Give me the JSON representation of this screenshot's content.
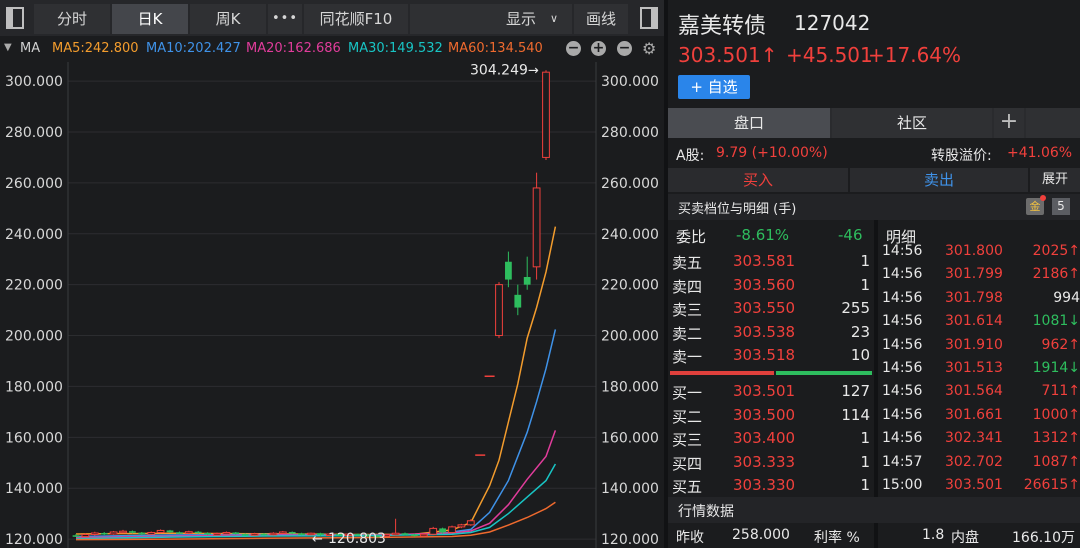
{
  "toolbar": {
    "tabs": [
      {
        "label": "分时",
        "active": false
      },
      {
        "label": "日K",
        "active": true
      },
      {
        "label": "周K",
        "active": false
      }
    ],
    "more_label": "•••",
    "f10_label": "同花顺F10",
    "display_label": "显示",
    "draw_label": "画线"
  },
  "ma_legend": {
    "label": "MA",
    "items": [
      {
        "text": "MA5:242.800",
        "color": "#f39c2d"
      },
      {
        "text": "MA10:202.427",
        "color": "#3f92e8"
      },
      {
        "text": "MA20:162.686",
        "color": "#e13c9b"
      },
      {
        "text": "MA30:149.532",
        "color": "#18c4c4"
      },
      {
        "text": "MA60:134.540",
        "color": "#ef6a2e"
      }
    ],
    "tools": [
      "−",
      "+",
      "−"
    ]
  },
  "colors": {
    "up": "#f0403c",
    "down": "#2ebd5e",
    "grid": "#2c2d30",
    "axis_text": "#d8d8d8",
    "ma5": "#f39c2d",
    "ma10": "#3f92e8",
    "ma20": "#e13c9b",
    "ma30": "#18c4c4",
    "ma60": "#ef6a2e"
  },
  "chart_data": {
    "type": "candlestick",
    "y_ticks": [
      "300.000",
      "280.000",
      "260.000",
      "240.000",
      "220.000",
      "200.000",
      "180.000",
      "160.000",
      "140.000",
      "120.000"
    ],
    "y_tick_values": [
      300,
      280,
      260,
      240,
      220,
      200,
      180,
      160,
      140,
      120
    ],
    "ylim": [
      116.5,
      307.5
    ],
    "max_label": "304.249",
    "max_value": 304.249,
    "min_label": "120.803",
    "min_value": 120.803,
    "candles": [
      {
        "o": 121.5,
        "c": 121.0,
        "h": 122.0,
        "l": 120.8
      },
      {
        "o": 121.0,
        "c": 121.8,
        "h": 122.3,
        "l": 120.8
      },
      {
        "o": 121.8,
        "c": 122.4,
        "h": 122.9,
        "l": 121.4
      },
      {
        "o": 122.4,
        "c": 122.0,
        "h": 122.8,
        "l": 121.6
      },
      {
        "o": 122.0,
        "c": 122.8,
        "h": 123.2,
        "l": 121.7
      },
      {
        "o": 122.8,
        "c": 123.1,
        "h": 123.6,
        "l": 122.4
      },
      {
        "o": 123.1,
        "c": 122.5,
        "h": 123.4,
        "l": 122.2
      },
      {
        "o": 122.5,
        "c": 121.9,
        "h": 122.8,
        "l": 121.5
      },
      {
        "o": 121.9,
        "c": 122.6,
        "h": 123.0,
        "l": 121.6
      },
      {
        "o": 122.6,
        "c": 123.4,
        "h": 123.8,
        "l": 122.3
      },
      {
        "o": 123.4,
        "c": 122.7,
        "h": 123.6,
        "l": 122.4
      },
      {
        "o": 122.7,
        "c": 122.3,
        "h": 123.0,
        "l": 122.0
      },
      {
        "o": 122.3,
        "c": 122.9,
        "h": 123.3,
        "l": 122.0
      },
      {
        "o": 122.9,
        "c": 122.4,
        "h": 123.2,
        "l": 122.1
      },
      {
        "o": 122.4,
        "c": 121.8,
        "h": 122.7,
        "l": 121.5
      },
      {
        "o": 121.8,
        "c": 122.2,
        "h": 122.6,
        "l": 121.5
      },
      {
        "o": 122.2,
        "c": 122.6,
        "h": 123.0,
        "l": 121.9
      },
      {
        "o": 122.6,
        "c": 122.0,
        "h": 122.8,
        "l": 121.7
      },
      {
        "o": 122.0,
        "c": 121.6,
        "h": 122.3,
        "l": 121.3
      },
      {
        "o": 121.6,
        "c": 122.1,
        "h": 122.5,
        "l": 121.3
      },
      {
        "o": 122.1,
        "c": 121.7,
        "h": 122.4,
        "l": 121.4
      },
      {
        "o": 121.7,
        "c": 122.3,
        "h": 122.7,
        "l": 121.4
      },
      {
        "o": 122.3,
        "c": 122.8,
        "h": 123.2,
        "l": 122.0
      },
      {
        "o": 122.8,
        "c": 122.2,
        "h": 123.0,
        "l": 121.9
      },
      {
        "o": 122.2,
        "c": 121.8,
        "h": 122.5,
        "l": 121.5
      },
      {
        "o": 121.8,
        "c": 122.3,
        "h": 122.6,
        "l": 121.5
      },
      {
        "o": 122.3,
        "c": 121.6,
        "h": 122.5,
        "l": 121.2
      },
      {
        "o": 121.6,
        "c": 122.0,
        "h": 122.4,
        "l": 121.2
      },
      {
        "o": 122.0,
        "c": 121.5,
        "h": 122.2,
        "l": 121.2
      },
      {
        "o": 121.5,
        "c": 122.0,
        "h": 122.3,
        "l": 121.2
      },
      {
        "o": 122.0,
        "c": 121.7,
        "h": 122.2,
        "l": 121.4
      },
      {
        "o": 121.7,
        "c": 121.3,
        "h": 121.9,
        "l": 120.9
      },
      {
        "o": 121.3,
        "c": 121.1,
        "h": 121.6,
        "l": 120.8
      },
      {
        "o": 121.1,
        "c": 121.7,
        "h": 122.0,
        "l": 120.8
      },
      {
        "o": 121.7,
        "c": 122.3,
        "h": 128.0,
        "l": 121.4
      },
      {
        "o": 122.3,
        "c": 121.8,
        "h": 122.6,
        "l": 121.4
      },
      {
        "o": 121.8,
        "c": 121.2,
        "h": 122.1,
        "l": 120.9
      },
      {
        "o": 121.2,
        "c": 121.9,
        "h": 122.2,
        "l": 120.9
      },
      {
        "o": 121.9,
        "c": 124.2,
        "h": 124.8,
        "l": 121.6
      },
      {
        "o": 124.2,
        "c": 122.6,
        "h": 124.5,
        "l": 122.2
      },
      {
        "o": 122.6,
        "c": 124.8,
        "h": 125.3,
        "l": 122.4
      },
      {
        "o": 124.8,
        "c": 125.6,
        "h": 126.0,
        "l": 124.3
      },
      {
        "o": 125.6,
        "c": 127.2,
        "h": 127.8,
        "l": 125.2
      },
      {
        "o": 153.0,
        "c": 153.0,
        "h": 153.0,
        "l": 153.0
      },
      {
        "o": 184.0,
        "c": 184.0,
        "h": 184.0,
        "l": 184.0
      },
      {
        "o": 200.0,
        "c": 220.0,
        "h": 221.0,
        "l": 199.0
      },
      {
        "o": 229.0,
        "c": 222.0,
        "h": 233.0,
        "l": 219.0
      },
      {
        "o": 216.0,
        "c": 211.0,
        "h": 220.0,
        "l": 208.0
      },
      {
        "o": 223.0,
        "c": 220.0,
        "h": 231.0,
        "l": 218.0
      },
      {
        "o": 227.0,
        "c": 258.0,
        "h": 264.0,
        "l": 222.0
      },
      {
        "o": 270.0,
        "c": 303.5,
        "h": 304.249,
        "l": 269.0
      }
    ],
    "ma": [
      {
        "name": "MA5",
        "color_key": "ma5",
        "values": [
          [
            0,
            122.0
          ],
          [
            10,
            122.3
          ],
          [
            20,
            122.1
          ],
          [
            30,
            121.8
          ],
          [
            36,
            121.9
          ],
          [
            40,
            123.6
          ],
          [
            42,
            126.5
          ],
          [
            44,
            141.0
          ],
          [
            45,
            151.0
          ],
          [
            46,
            166.0
          ],
          [
            47,
            181.0
          ],
          [
            48,
            199.0
          ],
          [
            49,
            211.0
          ],
          [
            50,
            225.0
          ],
          [
            51,
            242.8
          ]
        ]
      },
      {
        "name": "MA10",
        "color_key": "ma10",
        "values": [
          [
            0,
            121.0
          ],
          [
            10,
            121.6
          ],
          [
            20,
            121.8
          ],
          [
            30,
            121.6
          ],
          [
            38,
            121.8
          ],
          [
            42,
            123.8
          ],
          [
            44,
            130.5
          ],
          [
            46,
            143.0
          ],
          [
            48,
            162.0
          ],
          [
            49,
            174.0
          ],
          [
            50,
            187.0
          ],
          [
            51,
            202.4
          ]
        ]
      },
      {
        "name": "MA20",
        "color_key": "ma20",
        "values": [
          [
            0,
            120.6
          ],
          [
            10,
            121.1
          ],
          [
            20,
            121.6
          ],
          [
            30,
            121.4
          ],
          [
            40,
            122.4
          ],
          [
            42,
            123.2
          ],
          [
            44,
            126.2
          ],
          [
            46,
            133.5
          ],
          [
            48,
            143.5
          ],
          [
            50,
            152.5
          ],
          [
            51,
            162.7
          ]
        ]
      },
      {
        "name": "MA30",
        "color_key": "ma30",
        "values": [
          [
            0,
            120.2
          ],
          [
            10,
            120.8
          ],
          [
            20,
            121.2
          ],
          [
            30,
            121.3
          ],
          [
            40,
            121.9
          ],
          [
            42,
            122.6
          ],
          [
            44,
            124.6
          ],
          [
            46,
            130.0
          ],
          [
            48,
            136.5
          ],
          [
            50,
            143.0
          ],
          [
            51,
            149.5
          ]
        ]
      },
      {
        "name": "MA60",
        "color_key": "ma60",
        "values": [
          [
            0,
            119.8
          ],
          [
            10,
            120.0
          ],
          [
            20,
            120.3
          ],
          [
            30,
            120.6
          ],
          [
            40,
            121.0
          ],
          [
            42,
            121.5
          ],
          [
            44,
            122.8
          ],
          [
            46,
            125.5
          ],
          [
            48,
            128.5
          ],
          [
            50,
            132.0
          ],
          [
            51,
            134.5
          ]
        ]
      }
    ]
  },
  "quote": {
    "name": "嘉美转债",
    "code": "127042",
    "price": "303.501↑",
    "change": "+45.501",
    "change_pct": "+17.64%",
    "add_watch": "+ 自选"
  },
  "tabs2": {
    "panel": "盘口",
    "community": "社区",
    "plus": "+"
  },
  "a_share": {
    "label": "A股:",
    "value": "9.79 (+10.00%)",
    "premium_label": "转股溢价:",
    "premium_value": "+41.06%"
  },
  "actions": {
    "buy": "买入",
    "sell": "卖出",
    "expand": "展开"
  },
  "section": {
    "title": "买卖档位与明细 (手)",
    "badge_icon": "金",
    "badge_num": "5"
  },
  "weibi": {
    "label": "委比",
    "pct": "-8.61%",
    "diff": "-46"
  },
  "detail_label": "明细",
  "asks": [
    {
      "label": "卖五",
      "price": "303.581",
      "vol": "1"
    },
    {
      "label": "卖四",
      "price": "303.560",
      "vol": "1"
    },
    {
      "label": "卖三",
      "price": "303.550",
      "vol": "255"
    },
    {
      "label": "卖二",
      "price": "303.538",
      "vol": "23"
    },
    {
      "label": "卖一",
      "price": "303.518",
      "vol": "10"
    }
  ],
  "bids": [
    {
      "label": "买一",
      "price": "303.501",
      "vol": "127"
    },
    {
      "label": "买二",
      "price": "303.500",
      "vol": "114"
    },
    {
      "label": "买三",
      "price": "303.400",
      "vol": "1"
    },
    {
      "label": "买四",
      "price": "303.333",
      "vol": "1"
    },
    {
      "label": "买五",
      "price": "303.330",
      "vol": "1"
    }
  ],
  "ticks": [
    {
      "time": "14:56",
      "price": "301.800",
      "vol": "2025↑",
      "dir": "up"
    },
    {
      "time": "14:56",
      "price": "301.799",
      "vol": "2186↑",
      "dir": "up"
    },
    {
      "time": "14:56",
      "price": "301.798",
      "vol": "994",
      "dir": "none"
    },
    {
      "time": "14:56",
      "price": "301.614",
      "vol": "1081↓",
      "dir": "down"
    },
    {
      "time": "14:56",
      "price": "301.910",
      "vol": "962↑",
      "dir": "up"
    },
    {
      "time": "14:56",
      "price": "301.513",
      "vol": "1914↓",
      "dir": "down"
    },
    {
      "time": "14:56",
      "price": "301.564",
      "vol": "711↑",
      "dir": "up"
    },
    {
      "time": "14:56",
      "price": "301.661",
      "vol": "1000↑",
      "dir": "up"
    },
    {
      "time": "14:56",
      "price": "302.341",
      "vol": "1312↑",
      "dir": "up"
    },
    {
      "time": "14:57",
      "price": "302.702",
      "vol": "1087↑",
      "dir": "up"
    },
    {
      "time": "15:00",
      "price": "303.501",
      "vol": "26615↑",
      "dir": "up"
    }
  ],
  "market": {
    "title": "行情数据",
    "row": {
      "prev_label": "昨收",
      "prev_value": "258.000",
      "rate_label": "利率 %",
      "rate_value": "1.8",
      "inner_label": "内盘",
      "inner_value": "166.10万"
    }
  }
}
